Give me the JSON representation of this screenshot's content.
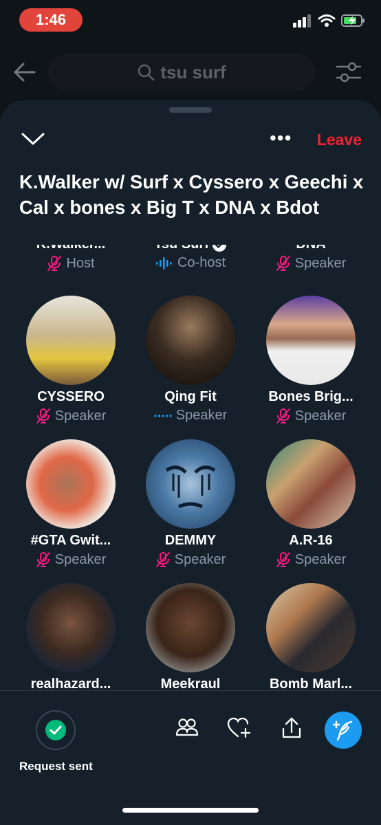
{
  "status": {
    "time": "1:46"
  },
  "search": {
    "query": "tsu surf"
  },
  "space": {
    "leave_label": "Leave",
    "title": "K.Walker w/ Surf x Cyssero x Geechi x Cal x bones x Big T x DNA x Bdot"
  },
  "participants": [
    {
      "name": "K.Walker...",
      "role": "Host",
      "icon": "muted-mic-icon",
      "verified": false
    },
    {
      "name": "Tsu Surf",
      "role": "Co-host",
      "icon": "speaking-wave-icon",
      "verified": true
    },
    {
      "name": "DNA",
      "role": "Speaker",
      "icon": "muted-mic-icon",
      "verified": false
    },
    {
      "name": "CYSSERO",
      "role": "Speaker",
      "icon": "muted-mic-icon",
      "verified": false
    },
    {
      "name": "Qing Fit",
      "role": "Speaker",
      "icon": "dots-icon",
      "verified": false
    },
    {
      "name": "Bones Brig...",
      "role": "Speaker",
      "icon": "muted-mic-icon",
      "verified": false
    },
    {
      "name": "#GTA Gwit...",
      "role": "Speaker",
      "icon": "muted-mic-icon",
      "verified": false
    },
    {
      "name": "DEMMY",
      "role": "Speaker",
      "icon": "muted-mic-icon",
      "verified": false
    },
    {
      "name": "A.R-16",
      "role": "Speaker",
      "icon": "muted-mic-icon",
      "verified": false
    },
    {
      "name": "realhazard...",
      "role": "",
      "icon": "",
      "verified": false
    },
    {
      "name": "Meekraul",
      "role": "",
      "icon": "",
      "verified": false
    },
    {
      "name": "Bomb Marl...",
      "role": "",
      "icon": "",
      "verified": false
    }
  ],
  "bottom": {
    "request_label": "Request sent"
  },
  "colors": {
    "accent": "#1d9bf0",
    "leave": "#f4212e",
    "muted": "#f91880",
    "background": "#15202b"
  }
}
